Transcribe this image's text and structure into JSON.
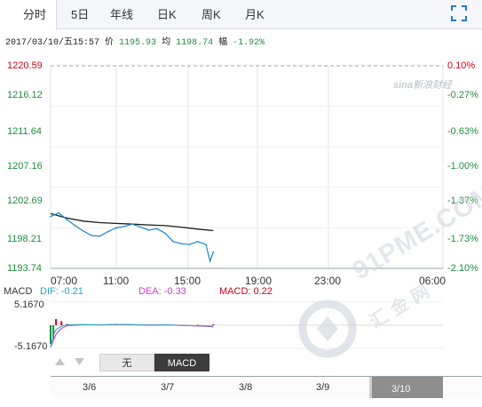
{
  "tabs": [
    {
      "label": "分时",
      "active": true
    },
    {
      "label": "5日",
      "active": false
    },
    {
      "label": "年线",
      "active": false
    },
    {
      "label": "日K",
      "active": false
    },
    {
      "label": "周K",
      "active": false
    },
    {
      "label": "月K",
      "active": false
    }
  ],
  "quote": {
    "datetime": "2017/03/10/五15:57",
    "price_label": "价",
    "price": "1195.93",
    "avg_label": "均",
    "avg": "1198.74",
    "change_label": "幅",
    "change": "-1.92%"
  },
  "watermark": {
    "brand": "sina新浪财经",
    "brand_prefix": "sina",
    "brand_suffix": "新浪财经",
    "site": "91PME.COM",
    "site_cn": "汇金网"
  },
  "indicator": {
    "name": "MACD",
    "dif_label": "DIF: -0.21",
    "dea_label": "DEA: -0.33",
    "macd_label": "MACD: 0.22",
    "axis_max": "5.1670",
    "axis_min": "-5.1670",
    "tab_none": "无",
    "tab_macd": "MACD"
  },
  "navigator": {
    "days": [
      "3/6",
      "3/7",
      "3/8",
      "3/9",
      "3/10"
    ],
    "selected": "3/10"
  },
  "colors": {
    "price_line": "#1a88c9",
    "avg_line": "#1a1a1a",
    "down": "#1e8e3e",
    "up": "#d0021b",
    "dif": "#2aa6c4",
    "dea": "#c941c9"
  },
  "chart_data": {
    "type": "line",
    "title": "",
    "y_left_ticks": [
      "1220.59",
      "1216.12",
      "1211.64",
      "1207.16",
      "1202.69",
      "1198.21",
      "1193.74"
    ],
    "y_right_ticks": [
      "0.10%",
      "-0.27%",
      "-0.63%",
      "-1.00%",
      "-1.37%",
      "-1.73%",
      "-2.10%"
    ],
    "x_ticks": [
      "07:00",
      "11:00",
      "15:00",
      "19:00",
      "23:00",
      "06:00"
    ],
    "ylim": [
      1193.74,
      1220.59
    ],
    "prev_close_level": 1220.59,
    "grid": true,
    "series": [
      {
        "key": "price",
        "x": [
          "06:00",
          "06:30",
          "07:00",
          "07:30",
          "08:00",
          "08:30",
          "09:00",
          "09:30",
          "10:00",
          "10:30",
          "11:00",
          "11:30",
          "12:00",
          "12:30",
          "13:00",
          "13:30",
          "14:00",
          "14:30",
          "15:00",
          "15:30",
          "15:45",
          "15:57"
        ],
        "values": [
          1200.6,
          1201.1,
          1200.2,
          1199.4,
          1198.7,
          1198.1,
          1198.0,
          1198.6,
          1199.1,
          1199.3,
          1199.6,
          1199.2,
          1198.8,
          1199.0,
          1198.4,
          1197.3,
          1197.0,
          1196.9,
          1197.3,
          1196.9,
          1194.7,
          1195.9
        ]
      },
      {
        "key": "average",
        "x": [
          "06:00",
          "07:00",
          "08:00",
          "09:00",
          "10:00",
          "11:00",
          "12:00",
          "13:00",
          "14:00",
          "15:00",
          "15:57"
        ],
        "values": [
          1201.0,
          1200.4,
          1200.0,
          1199.8,
          1199.7,
          1199.6,
          1199.5,
          1199.4,
          1199.2,
          1198.95,
          1198.74
        ]
      }
    ],
    "macd": {
      "x": [
        "06:00",
        "06:10",
        "06:20",
        "06:40",
        "07:00",
        "08:00",
        "09:00",
        "10:00",
        "11:00",
        "12:00",
        "13:00",
        "14:00",
        "15:00",
        "15:57"
      ],
      "dif": [
        -4.9,
        -2.2,
        -1.0,
        -0.2,
        0.1,
        0.15,
        0.05,
        0.2,
        0.15,
        0.0,
        0.1,
        -0.05,
        -0.1,
        -0.21
      ],
      "dea": [
        -4.9,
        -3.5,
        -2.0,
        -0.7,
        -0.1,
        0.1,
        0.1,
        0.15,
        0.1,
        0.05,
        0.05,
        0.0,
        -0.15,
        -0.33
      ],
      "hist": [
        -4.2,
        -3.0,
        1.4,
        0.9,
        0.3,
        0.15,
        0.1,
        0.1,
        0.05,
        0.05,
        0.1,
        0.1,
        0.1,
        0.22
      ]
    }
  }
}
